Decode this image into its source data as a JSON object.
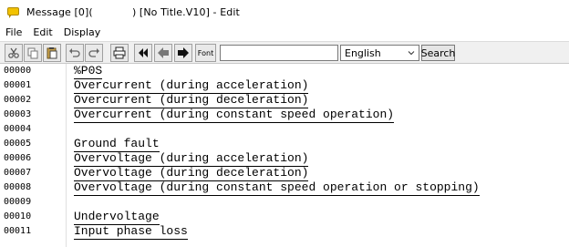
{
  "window": {
    "title": "Message [0](            ) [No Title.V10] - Edit"
  },
  "menu": [
    "File",
    "Edit",
    "Display"
  ],
  "toolbar": {
    "font_label": "Font",
    "search_value": "",
    "language": "English",
    "search_label": "Search"
  },
  "editor": {
    "line_numbers": [
      "00000",
      "00001",
      "00002",
      "00003",
      "00004",
      "00005",
      "00006",
      "00007",
      "00008",
      "00009",
      "00010",
      "00011"
    ],
    "lines": [
      "%P0S",
      "Overcurrent (during acceleration)",
      "Overcurrent (during deceleration)",
      "Overcurrent (during constant speed operation)",
      "",
      "Ground fault",
      "Overvoltage (during acceleration)",
      "Overvoltage (during deceleration)",
      "Overvoltage (during constant speed operation or stopping)",
      "",
      "Undervoltage",
      "Input phase loss"
    ]
  },
  "icons": [
    "message-icon",
    "cut-icon",
    "copy-icon",
    "paste-icon",
    "undo-icon",
    "redo-icon",
    "print-icon",
    "first-icon",
    "prev-icon",
    "next-icon",
    "font-icon",
    "chevron-down-icon"
  ]
}
